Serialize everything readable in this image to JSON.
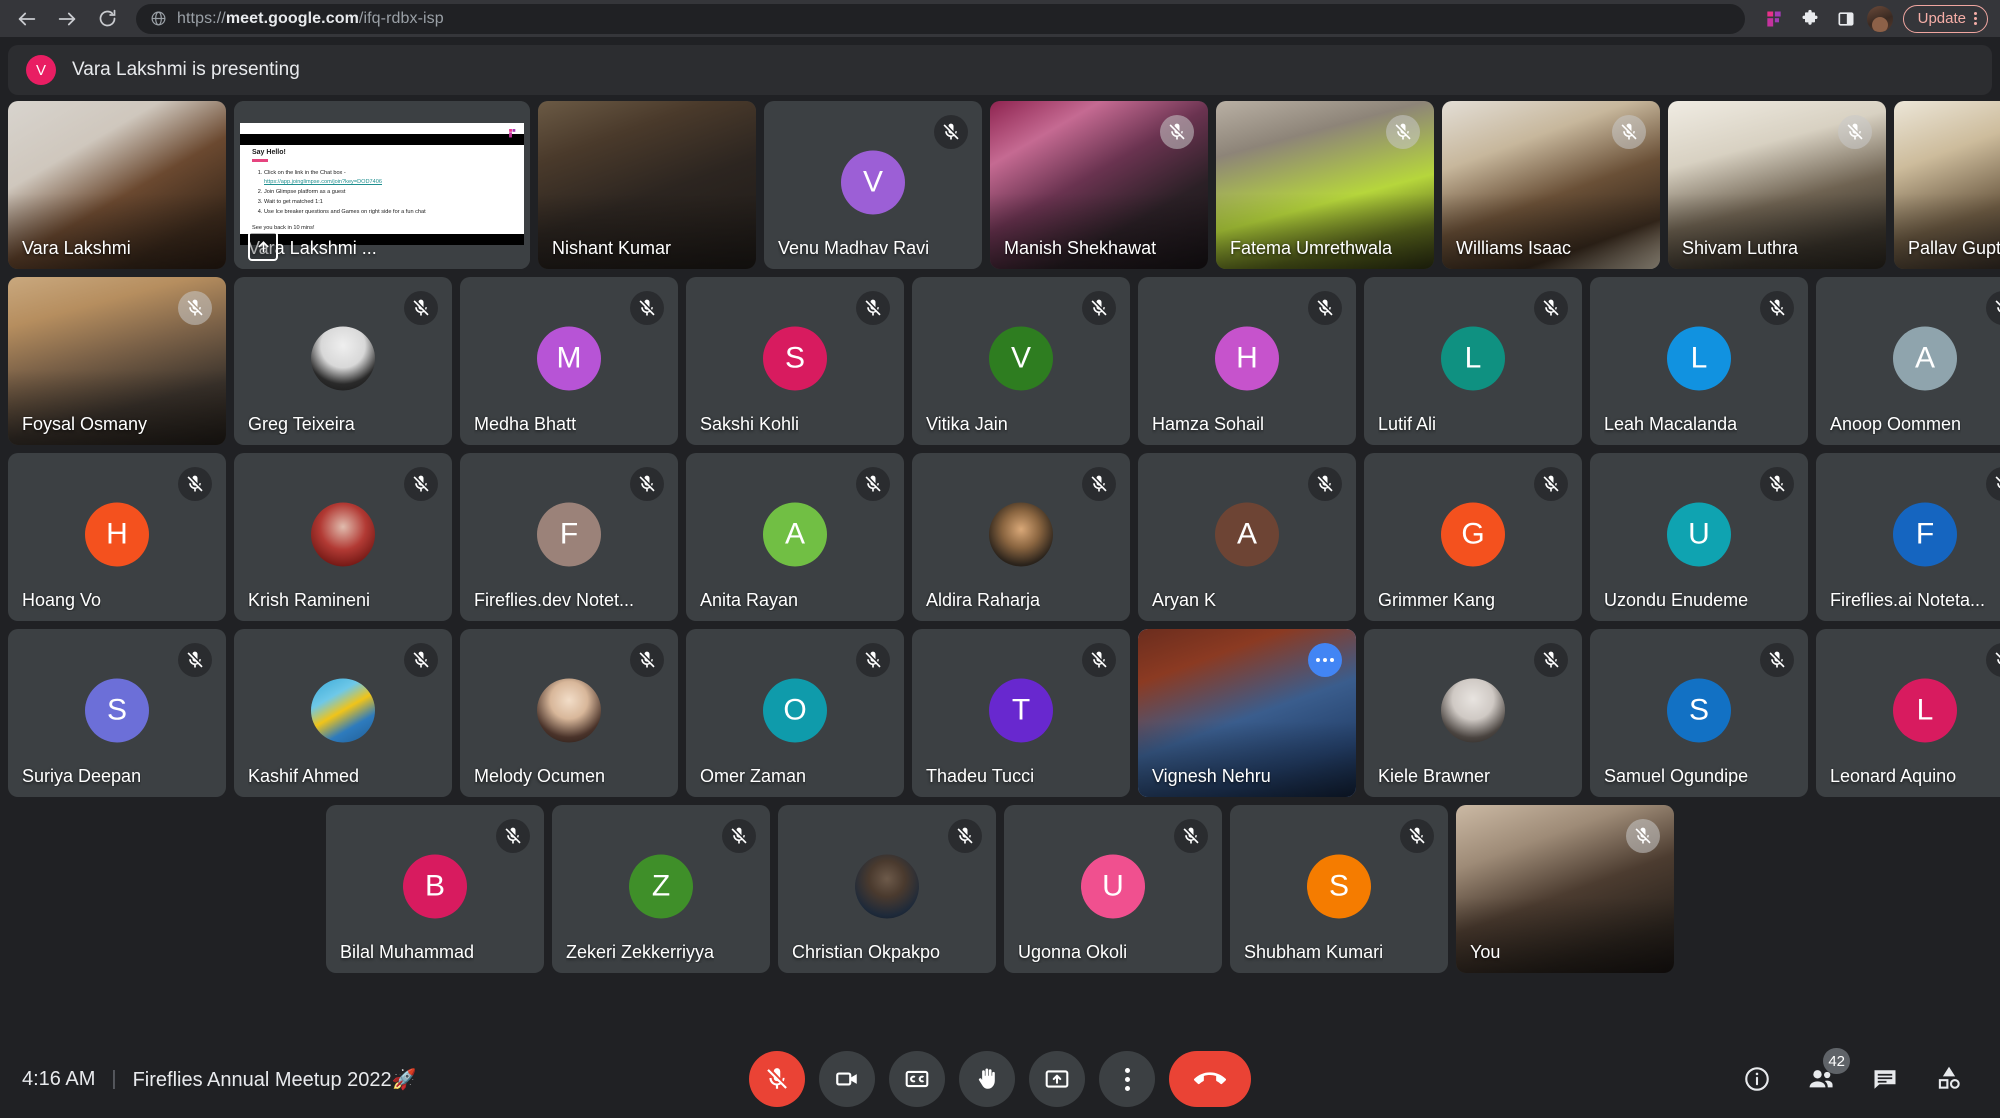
{
  "browser": {
    "url_prefix": "https://",
    "url_domain": "meet.google.com",
    "url_path": "/ifq-rdbx-isp",
    "back_icon": "back-arrow-icon",
    "forward_icon": "forward-arrow-icon",
    "reload_icon": "reload-icon",
    "site_icon": "globe-icon",
    "fireflies_icon": "fireflies-extension-icon",
    "extensions_icon": "puzzle-piece-icon",
    "sidepanel_icon": "side-panel-icon",
    "profile_icon": "profile-avatar",
    "update_label": "Update",
    "menu_icon": "chrome-menu-icon"
  },
  "banner": {
    "avatar_initial": "V",
    "avatar_color": "#e91e63",
    "text": "Vara Lakshmi is presenting"
  },
  "slide": {
    "title": "Say Hello!",
    "items": [
      "Click on the link in the Chat box -",
      "Join Glimpse platform as a guest",
      "Wait to get matched 1:1",
      "Use Ice breaker questions and Games on right side for a fun chat"
    ],
    "link": "https://app.joinglimpse.com/join?key=DOD7406",
    "footer": "See you back in 10 mins!"
  },
  "rows": [
    [
      {
        "name": "Vara Lakshmi",
        "kind": "video",
        "muted": false,
        "video": "vara"
      },
      {
        "name": "Vara Lakshmi ...",
        "kind": "slide",
        "wide": true,
        "muted": false
      },
      {
        "name": "Nishant Kumar",
        "kind": "video",
        "muted": false,
        "video": "nishant"
      },
      {
        "name": "Venu Madhav Ravi",
        "kind": "initial",
        "initial": "V",
        "color": "#9c5fd6",
        "muted": true
      },
      {
        "name": "Manish Shekhawat",
        "kind": "video",
        "muted": true,
        "mic_light": true,
        "video": "manish"
      },
      {
        "name": "Fatema Umrethwala",
        "kind": "video",
        "muted": true,
        "mic_light": true,
        "video": "fatema"
      },
      {
        "name": "Williams Isaac",
        "kind": "video",
        "muted": true,
        "mic_light": true,
        "video": "williams"
      },
      {
        "name": "Shivam Luthra",
        "kind": "video",
        "muted": true,
        "mic_light": true,
        "video": "shivam"
      },
      {
        "name": "Pallav Gupta",
        "kind": "video",
        "muted": true,
        "mic_light": true,
        "video": "pallav"
      }
    ],
    [
      {
        "name": "Foysal Osmany",
        "kind": "video",
        "muted": true,
        "mic_light": true,
        "video": "foysal"
      },
      {
        "name": "Greg Teixeira",
        "kind": "photo",
        "muted": true,
        "photo": "greg"
      },
      {
        "name": "Medha Bhatt",
        "kind": "initial",
        "initial": "M",
        "color": "#b754d6",
        "muted": true
      },
      {
        "name": "Sakshi Kohli",
        "kind": "initial",
        "initial": "S",
        "color": "#d81b5f",
        "muted": true
      },
      {
        "name": "Vitika Jain",
        "kind": "initial",
        "initial": "V",
        "color": "#2e7d20",
        "muted": true
      },
      {
        "name": "Hamza Sohail",
        "kind": "initial",
        "initial": "H",
        "color": "#c653cc",
        "muted": true
      },
      {
        "name": "Lutif Ali",
        "kind": "initial",
        "initial": "L",
        "color": "#0f9181",
        "muted": true
      },
      {
        "name": "Leah Macalanda",
        "kind": "initial",
        "initial": "L",
        "color": "#1192e0",
        "muted": true
      },
      {
        "name": "Anoop Oommen",
        "kind": "initial",
        "initial": "A",
        "color": "#8fa4ad",
        "muted": true
      }
    ],
    [
      {
        "name": "Hoang Vo",
        "kind": "initial",
        "initial": "H",
        "color": "#f4511e",
        "muted": true
      },
      {
        "name": "Krish Ramineni",
        "kind": "photo",
        "muted": true,
        "photo": "krish"
      },
      {
        "name": "Fireflies.dev Notet...",
        "kind": "initial",
        "initial": "F",
        "color": "#9b8279",
        "muted": true
      },
      {
        "name": "Anita Rayan",
        "kind": "initial",
        "initial": "A",
        "color": "#71bf44",
        "muted": true
      },
      {
        "name": "Aldira Raharja",
        "kind": "photo",
        "muted": true,
        "photo": "aldira"
      },
      {
        "name": "Aryan K",
        "kind": "initial",
        "initial": "A",
        "color": "#6d4434",
        "muted": true
      },
      {
        "name": "Grimmer Kang",
        "kind": "initial",
        "initial": "G",
        "color": "#f4511e",
        "muted": true
      },
      {
        "name": "Uzondu Enudeme",
        "kind": "initial",
        "initial": "U",
        "color": "#0fa3b1",
        "muted": true
      },
      {
        "name": "Fireflies.ai Noteta...",
        "kind": "initial",
        "initial": "F",
        "color": "#1565c0",
        "muted": true
      }
    ],
    [
      {
        "name": "Suriya Deepan",
        "kind": "initial",
        "initial": "S",
        "color": "#6c6fd8",
        "muted": true
      },
      {
        "name": "Kashif Ahmed",
        "kind": "photo",
        "muted": true,
        "photo": "kashif"
      },
      {
        "name": "Melody Ocumen",
        "kind": "photo",
        "muted": true,
        "photo": "melody"
      },
      {
        "name": "Omer Zaman",
        "kind": "initial",
        "initial": "O",
        "color": "#0f9bab",
        "muted": true
      },
      {
        "name": "Thadeu Tucci",
        "kind": "initial",
        "initial": "T",
        "color": "#6828cf",
        "muted": true
      },
      {
        "name": "Vignesh Nehru",
        "kind": "video",
        "selected": true,
        "more": true,
        "video": "vignesh"
      },
      {
        "name": "Kiele Brawner",
        "kind": "photo",
        "muted": true,
        "photo": "kiele"
      },
      {
        "name": "Samuel Ogundipe",
        "kind": "initial",
        "initial": "S",
        "color": "#1271c4",
        "muted": true
      },
      {
        "name": "Leonard Aquino",
        "kind": "initial",
        "initial": "L",
        "color": "#d81b5f",
        "muted": true
      }
    ],
    [
      {
        "name": "Bilal Muhammad",
        "kind": "initial",
        "initial": "B",
        "color": "#d81b5f",
        "muted": true
      },
      {
        "name": "Zekeri Zekkerriyya",
        "kind": "initial",
        "initial": "Z",
        "color": "#3f8f29",
        "muted": true
      },
      {
        "name": "Christian Okpakpo",
        "kind": "photo",
        "muted": true,
        "photo": "christian"
      },
      {
        "name": "Ugonna Okoli",
        "kind": "initial",
        "initial": "U",
        "color": "#f0508f",
        "muted": true
      },
      {
        "name": "Shubham Kumari",
        "kind": "initial",
        "initial": "S",
        "color": "#f57c00",
        "muted": true
      },
      {
        "name": "You",
        "kind": "video",
        "muted": true,
        "mic_light": true,
        "video": "you"
      }
    ]
  ],
  "bottom": {
    "time": "4:16 AM",
    "separator": "|",
    "meeting_title": "Fireflies Annual Meetup 2022🚀",
    "controls": [
      {
        "name": "microphone-toggle-button",
        "icon": "mic-off-icon",
        "state": "muted"
      },
      {
        "name": "camera-toggle-button",
        "icon": "camera-icon",
        "state": "on"
      },
      {
        "name": "captions-button",
        "icon": "closed-caption-icon",
        "state": "off"
      },
      {
        "name": "raise-hand-button",
        "icon": "raised-hand-icon",
        "state": "off"
      },
      {
        "name": "present-screen-button",
        "icon": "present-to-all-icon",
        "state": "off"
      },
      {
        "name": "more-options-button",
        "icon": "more-vertical-icon",
        "state": "off"
      },
      {
        "name": "leave-call-button",
        "icon": "hang-up-icon",
        "state": "danger"
      }
    ],
    "right": {
      "info_icon": "info-icon",
      "people_icon": "people-icon",
      "people_count": "42",
      "chat_icon": "chat-icon",
      "activities_icon": "activities-icon"
    }
  }
}
